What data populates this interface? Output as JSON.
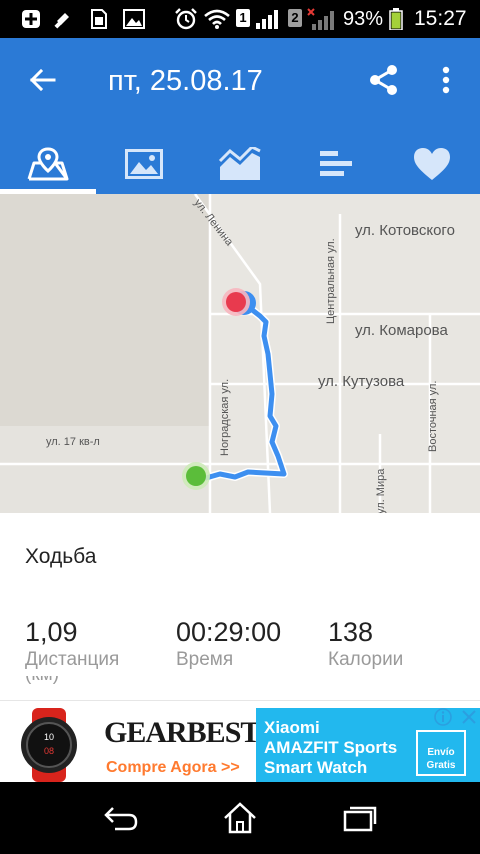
{
  "status_bar": {
    "sim1_label": "1",
    "sim2_label": "2",
    "battery_percent": "93%",
    "time": "15:27",
    "icons": [
      "plus-box-icon",
      "flashlight-icon",
      "sim-card-icon",
      "gallery-icon",
      "alarm-icon",
      "wifi-icon",
      "signal-icon",
      "battery-icon"
    ]
  },
  "app_bar": {
    "title": "пт, 25.08.17",
    "back_icon": "arrow-left-icon",
    "share_icon": "share-icon",
    "more_icon": "more-vertical-icon",
    "color": "#2b7ad6"
  },
  "tabs": [
    {
      "icon": "map-icon",
      "selected": true
    },
    {
      "icon": "photo-icon",
      "selected": false
    },
    {
      "icon": "chart-icon",
      "selected": false
    },
    {
      "icon": "bars-icon",
      "selected": false
    },
    {
      "icon": "heart-icon",
      "selected": false
    }
  ],
  "map": {
    "streets": {
      "lenina": "ул. Ленина",
      "kotovskogo": "ул. Котовского",
      "tsentralnaya": "Центральная ул.",
      "komarova": "ул. Комарова",
      "kutuzova": "ул. Кутузова",
      "nogradskaya": "Ноградская ул.",
      "vostochnaya": "Восточная ул.",
      "kv17": "ул. 17 кв-л",
      "mira": "ул. Мира"
    },
    "route_color": "#3d8ff0",
    "start_color": "#5bbd3a",
    "end_color": "#e83a4e"
  },
  "summary": {
    "activity": "Ходьба",
    "stats": [
      {
        "value": "1,09",
        "label": "Дистанция"
      },
      {
        "value": "00:29:00",
        "label": "Время"
      },
      {
        "value": "138",
        "label": "Калории"
      }
    ],
    "partial_unit": "(км)"
  },
  "ad": {
    "brand": "GEARBEST",
    "cta": "Compre Agora >>",
    "product_line1": "Xiaomi",
    "product_line2": "AMAZFIT Sports",
    "product_line3": "Smart Watch",
    "badge_line1": "Envío",
    "badge_line2": "Gratis"
  },
  "nav_bar": {
    "buttons": [
      "back-nav-icon",
      "home-nav-icon",
      "recents-nav-icon"
    ]
  }
}
